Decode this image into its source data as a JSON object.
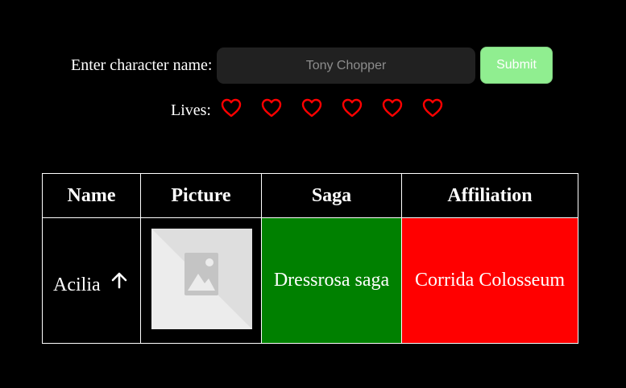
{
  "form": {
    "label": "Enter character name:",
    "input_placeholder": "Tony Chopper",
    "input_value": "",
    "submit_label": "Submit"
  },
  "lives": {
    "label": "Lives:",
    "count": 6,
    "icon": "heart-outline-icon",
    "color": "#ff0000"
  },
  "table": {
    "headers": [
      "Name",
      "Picture",
      "Saga",
      "Affiliation"
    ],
    "rows": [
      {
        "name": "Acilia",
        "name_hint_icon": "arrow-up-icon",
        "picture_icon": "image-placeholder-icon",
        "saga": "Dressrosa saga",
        "saga_color": "#008000",
        "affiliation": "Corrida Colosseum",
        "affiliation_color": "#ff0000"
      }
    ]
  },
  "colors": {
    "background": "#000000",
    "submit_button": "#90ee90",
    "input_background": "#212121"
  }
}
